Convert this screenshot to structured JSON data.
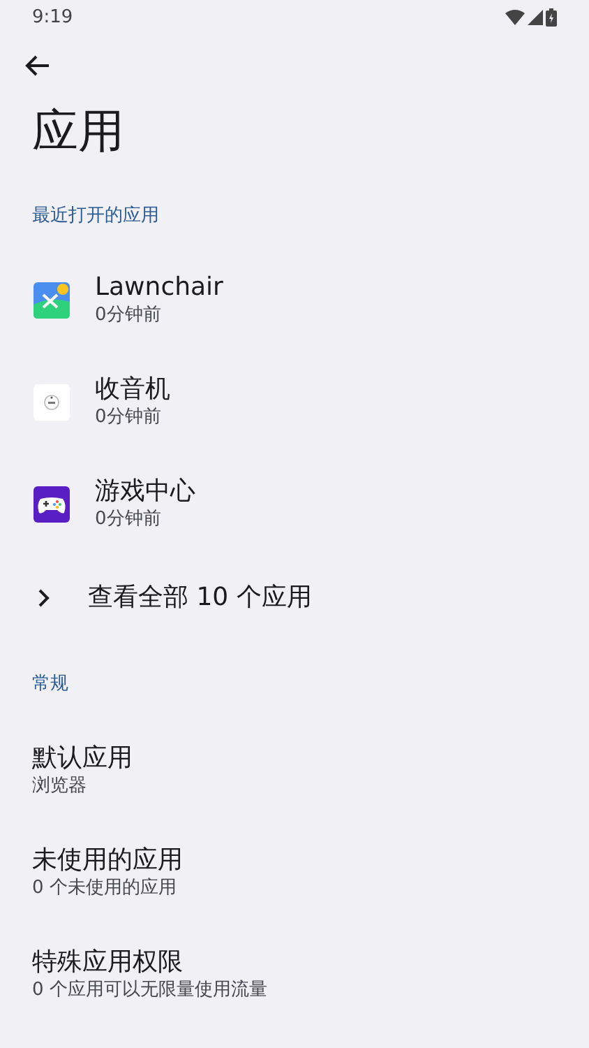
{
  "status_bar": {
    "time": "9:19"
  },
  "title": "应用",
  "recent": {
    "header": "最近打开的应用",
    "apps": [
      {
        "kind": "launcher",
        "name": "Lawnchair",
        "time": "0分钟前"
      },
      {
        "kind": "radio",
        "name": "收音机",
        "time": "0分钟前"
      },
      {
        "kind": "game",
        "name": "游戏中心",
        "time": "0分钟前"
      }
    ],
    "see_all": "查看全部 10 个应用"
  },
  "general": {
    "header": "常规",
    "items": [
      {
        "title": "默认应用",
        "summary": "浏览器"
      },
      {
        "title": "未使用的应用",
        "summary": "0 个未使用的应用"
      },
      {
        "title": "特殊应用权限",
        "summary": "0 个应用可以无限量使用流量"
      }
    ]
  }
}
